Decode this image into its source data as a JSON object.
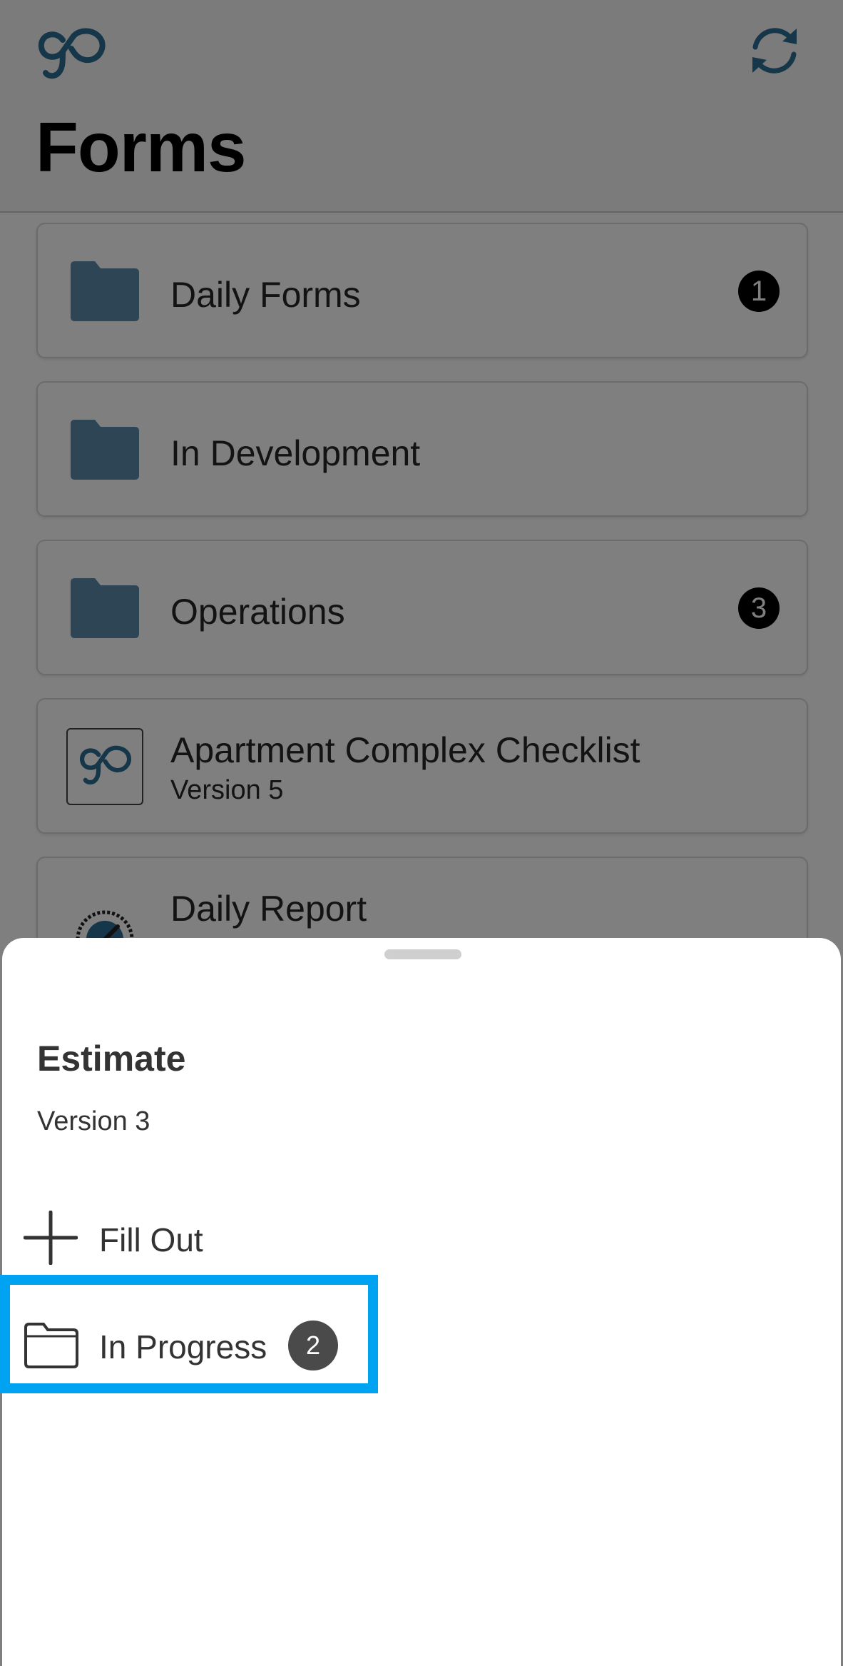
{
  "colors": {
    "brand": "#2a6e93",
    "folder": "#5b8aa8",
    "highlight": "#00a3f1",
    "badge_dark": "#000000",
    "badge_grey": "#4a4a4a"
  },
  "header": {
    "logo_icon": "go-logo-icon",
    "sync_icon": "refresh-icon",
    "title": "Forms"
  },
  "list": {
    "items": [
      {
        "type": "folder",
        "title": "Daily Forms",
        "count": "1"
      },
      {
        "type": "folder",
        "title": "In Development"
      },
      {
        "type": "folder",
        "title": "Operations",
        "count": "3"
      },
      {
        "type": "form",
        "title": "Apartment Complex Checklist",
        "subtitle": "Version 5"
      },
      {
        "type": "form",
        "title": "Daily Report"
      }
    ]
  },
  "sheet": {
    "title": "Estimate",
    "version": "Version 3",
    "actions": [
      {
        "label": "Fill Out",
        "icon": "plus-icon"
      },
      {
        "label": "In Progress",
        "icon": "folder-outline-icon",
        "count": "2"
      }
    ]
  }
}
